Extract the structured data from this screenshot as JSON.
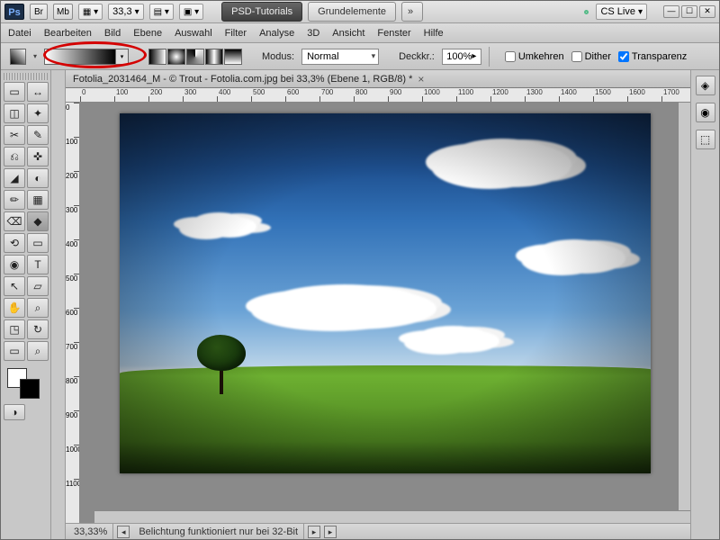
{
  "topbar": {
    "br": "Br",
    "mb": "Mb",
    "zoom": "33,3",
    "ws_tutorials": "PSD-Tutorials",
    "ws_basic": "Grundelemente",
    "more": "»",
    "cslive": "CS Live"
  },
  "menu": [
    "Datei",
    "Bearbeiten",
    "Bild",
    "Ebene",
    "Auswahl",
    "Filter",
    "Analyse",
    "3D",
    "Ansicht",
    "Fenster",
    "Hilfe"
  ],
  "options": {
    "mode_label": "Modus:",
    "mode_value": "Normal",
    "opacity_label": "Deckkr.:",
    "opacity_value": "100%",
    "reverse": "Umkehren",
    "dither": "Dither",
    "transparency": "Transparenz"
  },
  "doc": {
    "title": "Fotolia_2031464_M - © Trout - Fotolia.com.jpg bei 33,3% (Ebene 1, RGB/8) *"
  },
  "ruler_h": [
    0,
    100,
    200,
    300,
    400,
    500,
    600,
    700,
    800,
    900,
    1000,
    1100,
    1200,
    1300,
    1400,
    1500,
    1600,
    1700
  ],
  "ruler_v": [
    0,
    100,
    200,
    300,
    400,
    500,
    600,
    700,
    800,
    900,
    1000,
    1100
  ],
  "status": {
    "zoom": "33,33%",
    "msg": "Belichtung funktioniert nur bei 32-Bit"
  },
  "tool_glyphs": [
    "▭",
    "↔",
    "◫",
    "✦",
    "✂",
    "✎",
    "⎌",
    "✜",
    "◢",
    "◐",
    "✏",
    "▦",
    "⌫",
    "◆",
    "⟲",
    "▭",
    "◉",
    "T",
    "↖",
    "▱",
    "✋",
    "⌕",
    "◳",
    "↻",
    "▭",
    "⌕"
  ]
}
